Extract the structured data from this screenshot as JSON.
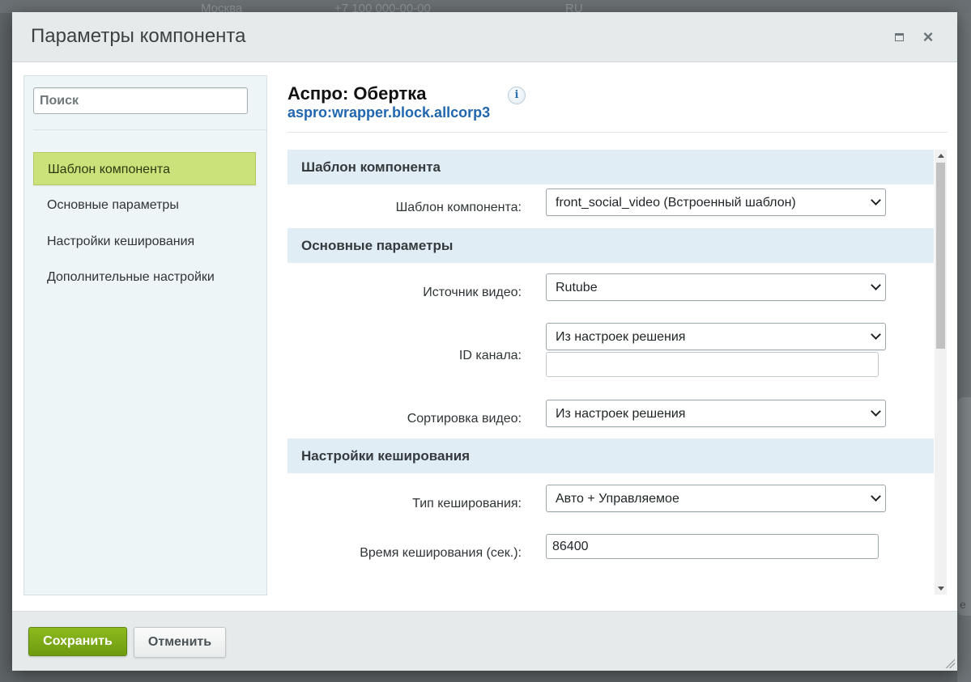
{
  "background": {
    "items": [
      "Москва",
      "+7 100 000-00-00",
      "RU"
    ],
    "side_letter": "е"
  },
  "dialog": {
    "title": "Параметры компонента"
  },
  "sidebar": {
    "search_placeholder": "Поиск",
    "items": [
      {
        "label": "Шаблон компонента",
        "active": true
      },
      {
        "label": "Основные параметры",
        "active": false
      },
      {
        "label": "Настройки кеширования",
        "active": false
      },
      {
        "label": "Дополнительные настройки",
        "active": false
      }
    ]
  },
  "component": {
    "name": "Аспро: Обертка",
    "code": "aspro:wrapper.block.allcorp3",
    "info_glyph": "i"
  },
  "sections": {
    "template": {
      "title": "Шаблон компонента",
      "template_label": "Шаблон компонента:",
      "template_value": "front_social_video (Встроенный шаблон)"
    },
    "main": {
      "title": "Основные параметры",
      "video_source_label": "Источник видео:",
      "video_source_value": "Rutube",
      "channel_id_label": "ID канала:",
      "channel_id_select": "Из настроек решения",
      "channel_id_input": "",
      "sort_label": "Сортировка видео:",
      "sort_value": "Из настроек решения"
    },
    "cache": {
      "title": "Настройки кеширования",
      "type_label": "Тип кеширования:",
      "type_value": "Авто + Управляемое",
      "time_label": "Время кеширования (сек.):",
      "time_value": "86400"
    }
  },
  "footer": {
    "save_label": "Сохранить",
    "cancel_label": "Отменить"
  },
  "colors": {
    "accent_green": "#8cba1d",
    "active_item": "#cbe27a",
    "section_bg": "#e1edf5",
    "link_blue": "#2067b0"
  }
}
